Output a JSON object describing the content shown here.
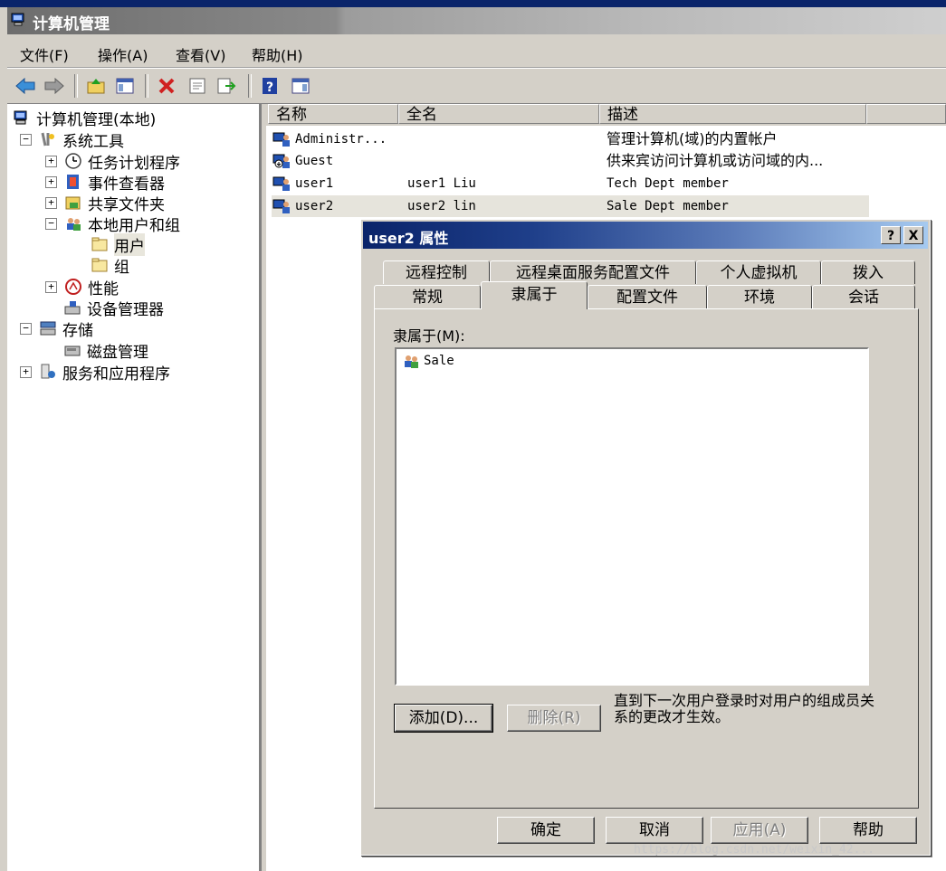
{
  "window": {
    "title": "计算机管理"
  },
  "menu": [
    {
      "label": "文件(F)"
    },
    {
      "label": "操作(A)"
    },
    {
      "label": "查看(V)"
    },
    {
      "label": "帮助(H)"
    }
  ],
  "toolbar": {
    "icons": [
      "back-icon",
      "forward-icon",
      "up-folder-icon",
      "show-hide-tree-icon",
      "delete-icon",
      "properties-icon",
      "export-list-icon",
      "help-icon",
      "show-hide-action-pane-icon"
    ]
  },
  "tree": {
    "root": "计算机管理(本地)",
    "system_tools": "系统工具",
    "task_scheduler": "任务计划程序",
    "event_viewer": "事件查看器",
    "shared_folders": "共享文件夹",
    "local_users_groups": "本地用户和组",
    "users": "用户",
    "groups": "组",
    "performance": "性能",
    "device_manager": "设备管理器",
    "storage": "存储",
    "disk_management": "磁盘管理",
    "services_apps": "服务和应用程序"
  },
  "list": {
    "columns": [
      "名称",
      "全名",
      "描述"
    ],
    "rows": [
      {
        "name": "Administr...",
        "fullname": "",
        "desc": "管理计算机(域)的内置帐户"
      },
      {
        "name": "Guest",
        "fullname": "",
        "desc": "供来宾访问计算机或访问域的内..."
      },
      {
        "name": "user1",
        "fullname": "user1 Liu",
        "desc": "Tech Dept member"
      },
      {
        "name": "user2",
        "fullname": "user2 lin",
        "desc": "Sale Dept member"
      }
    ]
  },
  "dialog": {
    "title": "user2 属性",
    "help_btn": "?",
    "close_btn": "X",
    "tabs_row1": [
      "远程控制",
      "远程桌面服务配置文件",
      "个人虚拟机",
      "拨入"
    ],
    "tabs_row2": [
      "常规",
      "隶属于",
      "配置文件",
      "环境",
      "会话"
    ],
    "active_tab": "隶属于",
    "member_of_label": "隶属于(M):",
    "groups": [
      "Sale"
    ],
    "add_button": "添加(D)...",
    "remove_button": "删除(R)",
    "note": "直到下一次用户登录时对用户的组成员关系的更改才生效。",
    "ok": "确定",
    "cancel": "取消",
    "apply": "应用(A)",
    "help": "帮助"
  },
  "watermark": "https://blog.csdn.net/weixin_42..."
}
